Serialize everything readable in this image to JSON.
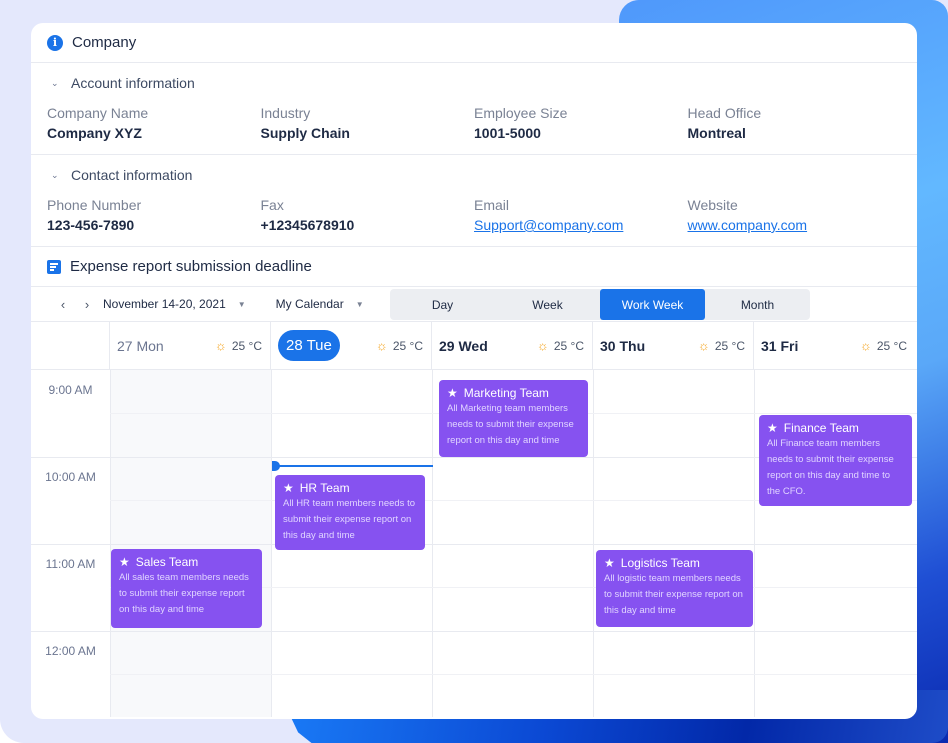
{
  "company_section": {
    "title": "Company",
    "account": {
      "title": "Account information",
      "fields": [
        {
          "label": "Company Name",
          "value": "Company XYZ"
        },
        {
          "label": "Industry",
          "value": "Supply Chain"
        },
        {
          "label": "Employee Size",
          "value": "1001-5000"
        },
        {
          "label": "Head Office",
          "value": "Montreal"
        }
      ]
    },
    "contact": {
      "title": "Contact information",
      "fields": [
        {
          "label": "Phone Number",
          "value": "123-456-7890"
        },
        {
          "label": "Fax",
          "value": "+12345678910"
        },
        {
          "label": "Email",
          "value": "Support@company.com"
        },
        {
          "label": "Website",
          "value": "www.company.com"
        }
      ]
    }
  },
  "calendar": {
    "title": "Expense report submission deadline",
    "date_range": "November 14-20, 2021",
    "calendar_select": "My Calendar",
    "views": [
      "Day",
      "Week",
      "Work Week",
      "Month"
    ],
    "active_view": "Work Week",
    "days": [
      {
        "label": "27 Mon",
        "weather": "25 °C"
      },
      {
        "label": "28 Tue",
        "weather": "25 °C",
        "today": true
      },
      {
        "label": "29 Wed",
        "weather": "25 °C"
      },
      {
        "label": "30 Thu",
        "weather": "25 °C"
      },
      {
        "label": "31 Fri",
        "weather": "25 °C"
      }
    ],
    "times": [
      "9:00 AM",
      "10:00 AM",
      "11:00 AM",
      "12:00 AM"
    ],
    "events": [
      {
        "title": "Marketing Team",
        "desc": "All Marketing team members needs to submit their expense report on this day and time"
      },
      {
        "title": "Finance Team",
        "desc": "All Finance team members needs to submit their expense report on this day and time to the CFO."
      },
      {
        "title": "HR Team",
        "desc": "All HR team members needs to submit their expense report on this day and time"
      },
      {
        "title": "Sales Team",
        "desc": "All sales team members needs to submit their expense report on this day and time"
      },
      {
        "title": "Logistics Team",
        "desc": "All logistic team members needs to submit their expense report on this day and time"
      }
    ],
    "colors": {
      "accent": "#1a73e8",
      "event": "#8652f0"
    }
  }
}
